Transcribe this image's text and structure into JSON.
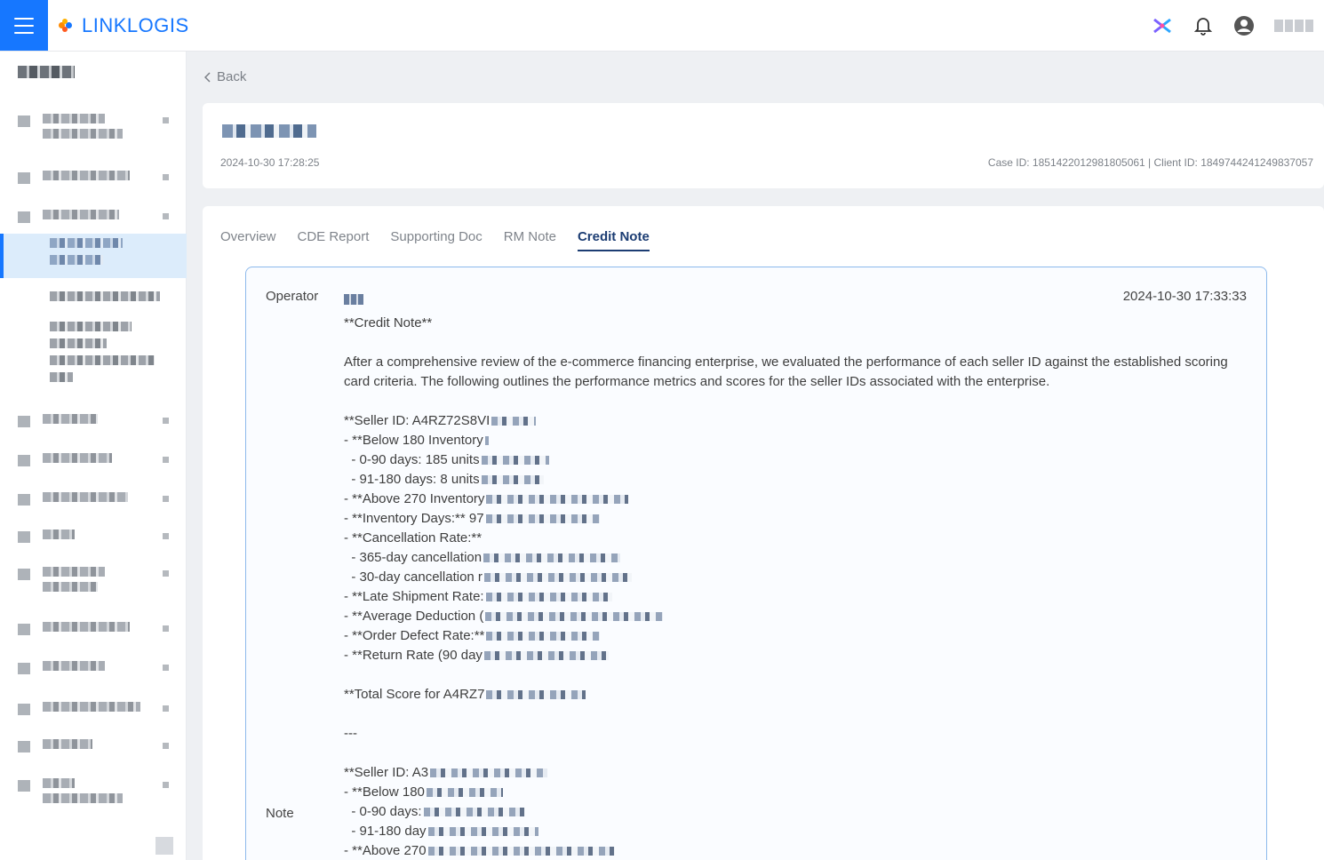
{
  "brand": {
    "name": "LINKLOGIS",
    "accent": "#1677ff"
  },
  "topbar": {
    "icons": [
      "menu-icon",
      "app-switch-icon",
      "bell-icon",
      "user-icon"
    ]
  },
  "nav": {
    "back_label": "Back"
  },
  "case": {
    "date": "2024-10-30 17:28:25",
    "ids": "Case ID: 1851422012981805061 | Client ID: 1849744241249837057"
  },
  "tabs": [
    {
      "label": "Overview"
    },
    {
      "label": "CDE Report"
    },
    {
      "label": "Supporting Doc"
    },
    {
      "label": "RM Note"
    },
    {
      "label": "Credit Note"
    }
  ],
  "active_tab": "Credit Note",
  "note": {
    "operator_label": "Operator",
    "note_label": "Note",
    "timestamp": "2024-10-30 17:33:33",
    "heading": "**Credit Note**",
    "intro": "After a comprehensive review of the e-commerce financing enterprise, we evaluated the performance of each seller ID against the established scoring card criteria. The following outlines the performance metrics and scores for the seller IDs associated with the enterprise.",
    "lines1": [
      "**Seller ID: A4RZ72S8VI",
      "- **Below 180 Inventory",
      "  - 0-90 days: 185 units",
      "  - 91-180 days: 8 units",
      "- **Above 270 Inventory",
      "- **Inventory Days:** 97",
      "- **Cancellation Rate:**",
      "  - 365-day cancellation",
      "  - 30-day cancellation r",
      "- **Late Shipment Rate:",
      "- **Average Deduction (",
      "- **Order Defect Rate:**",
      "- **Return Rate (90 day"
    ],
    "total": "**Total Score for A4RZ7",
    "separator": "---",
    "lines2": [
      "**Seller ID: A3",
      "- **Below 180",
      "  - 0-90 days:",
      "  - 91-180 day",
      "- **Above 270"
    ]
  }
}
